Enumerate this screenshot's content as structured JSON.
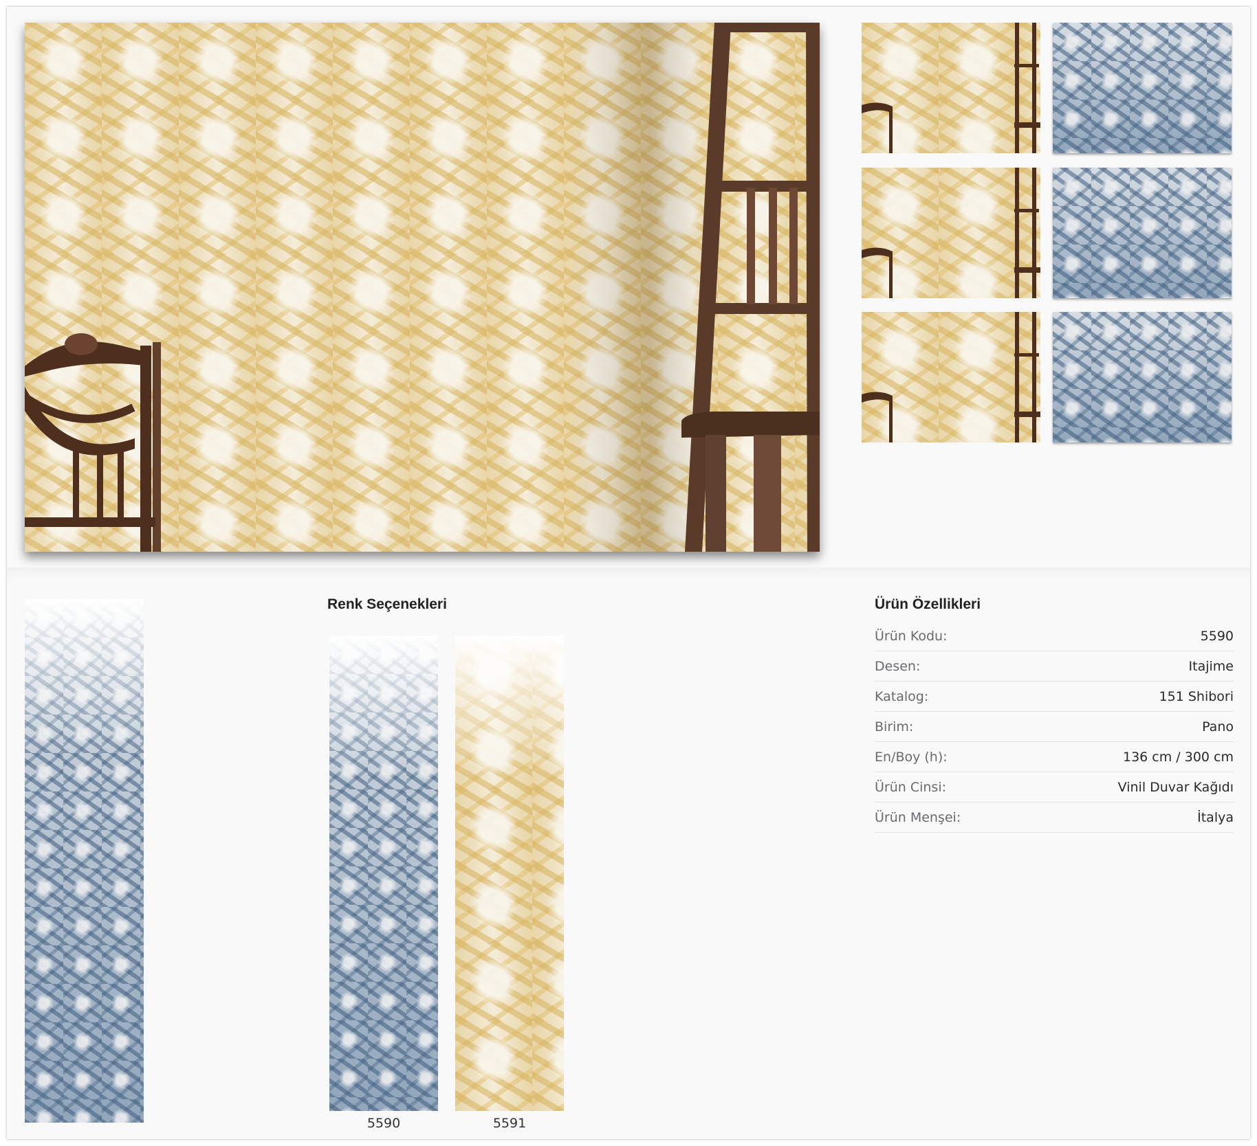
{
  "gallery": {
    "main_image": "wallpaper-room-photo",
    "thumbnails": [
      {
        "variant": "gold"
      },
      {
        "variant": "blue"
      },
      {
        "variant": "gold"
      },
      {
        "variant": "blue"
      },
      {
        "variant": "gold"
      },
      {
        "variant": "blue"
      }
    ]
  },
  "colors": {
    "gold": "#e0c27a",
    "blue": "#6d87a6",
    "wood": "#5a3a28"
  },
  "color_options": {
    "title": "Renk Seçenekleri",
    "items": [
      {
        "code": "5590",
        "variant": "blue"
      },
      {
        "code": "5591",
        "variant": "gold"
      }
    ]
  },
  "specs": {
    "title": "Ürün Özellikleri",
    "rows": [
      {
        "label": "Ürün Kodu:",
        "value": "5590"
      },
      {
        "label": "Desen:",
        "value": "Itajime"
      },
      {
        "label": "Katalog:",
        "value": "151 Shibori"
      },
      {
        "label": "Birim:",
        "value": "Pano"
      },
      {
        "label": "En/Boy (h):",
        "value": "136 cm / 300 cm"
      },
      {
        "label": "Ürün Cinsi:",
        "value": "Vinil Duvar Kağıdı"
      },
      {
        "label": "Ürün Menşei:",
        "value": "İtalya"
      }
    ]
  }
}
